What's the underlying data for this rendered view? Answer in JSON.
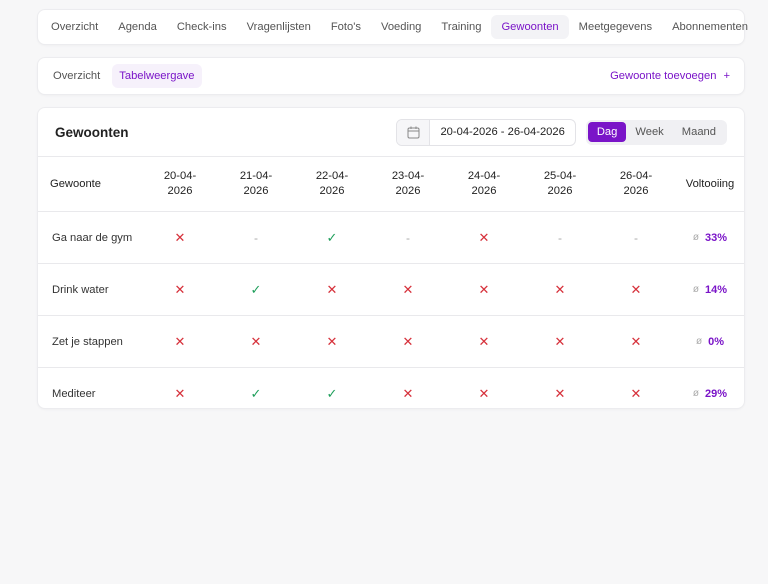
{
  "top_nav": {
    "tabs": [
      {
        "label": "Overzicht",
        "active": false
      },
      {
        "label": "Agenda",
        "active": false
      },
      {
        "label": "Check-ins",
        "active": false
      },
      {
        "label": "Vragenlijsten",
        "active": false
      },
      {
        "label": "Foto's",
        "active": false
      },
      {
        "label": "Voeding",
        "active": false
      },
      {
        "label": "Training",
        "active": false
      },
      {
        "label": "Gewoonten",
        "active": true
      },
      {
        "label": "Meetgegevens",
        "active": false
      },
      {
        "label": "Abonnementen",
        "active": false
      }
    ]
  },
  "sub_nav": {
    "tabs": [
      {
        "label": "Overzicht",
        "active": false
      },
      {
        "label": "Tabelweergave",
        "active": true
      }
    ],
    "add_label": "Gewoonte toevoegen",
    "add_icon": "+"
  },
  "card": {
    "title": "Gewoonten",
    "date_range": "20-04-2026 - 26-04-2026",
    "calendar_icon": "calendar-icon",
    "view_options": [
      {
        "label": "Dag",
        "active": true
      },
      {
        "label": "Week",
        "active": false
      },
      {
        "label": "Maand",
        "active": false
      }
    ]
  },
  "table": {
    "habit_header": "Gewoonte",
    "completion_header": "Voltooiing",
    "dates": [
      {
        "line1": "20-04-",
        "line2": "2026"
      },
      {
        "line1": "21-04-",
        "line2": "2026"
      },
      {
        "line1": "22-04-",
        "line2": "2026"
      },
      {
        "line1": "23-04-",
        "line2": "2026"
      },
      {
        "line1": "24-04-",
        "line2": "2026"
      },
      {
        "line1": "25-04-",
        "line2": "2026"
      },
      {
        "line1": "26-04-",
        "line2": "2026"
      }
    ],
    "avg_symbol": "ø",
    "rows": [
      {
        "name": "Ga naar de gym",
        "cells": [
          "x",
          "-",
          "check",
          "-",
          "x",
          "-",
          "-"
        ],
        "completion": "33%"
      },
      {
        "name": "Drink water",
        "cells": [
          "x",
          "check",
          "x",
          "x",
          "x",
          "x",
          "x"
        ],
        "completion": "14%"
      },
      {
        "name": "Zet je stappen",
        "cells": [
          "x",
          "x",
          "x",
          "x",
          "x",
          "x",
          "x"
        ],
        "completion": "0%"
      },
      {
        "name": "Mediteer",
        "cells": [
          "x",
          "check",
          "check",
          "x",
          "x",
          "x",
          "x"
        ],
        "completion": "29%"
      }
    ],
    "symbols": {
      "x": "✕",
      "check": "✓",
      "-": "-"
    },
    "colors": {
      "accent": "#7a14c8",
      "fail": "#d6303a",
      "success": "#1e9e5a"
    }
  }
}
